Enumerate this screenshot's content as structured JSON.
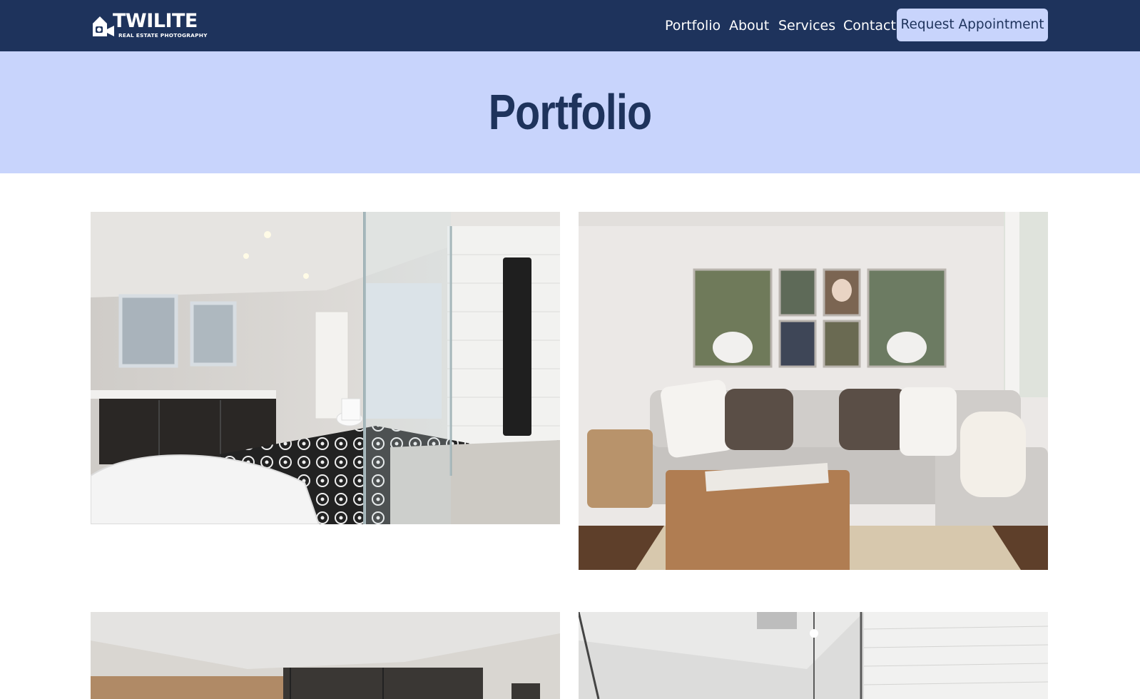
{
  "brand": {
    "name": "TWILITE",
    "tagline": "REAL ESTATE PHOTOGRAPHY",
    "logo_icon": "house-camera-icon"
  },
  "nav": {
    "items": [
      {
        "label": "Portfolio"
      },
      {
        "label": "About"
      },
      {
        "label": "Services"
      },
      {
        "label": "Contact"
      }
    ],
    "cta_label": "Request Appointment"
  },
  "hero": {
    "title": "Portfolio"
  },
  "colors": {
    "nav_bg": "#1e335c",
    "accent": "#c8d4fc",
    "title": "#1e335c"
  },
  "gallery": {
    "photos": [
      {
        "subject": "bathroom-photo"
      },
      {
        "subject": "living-room-photo"
      },
      {
        "subject": "bedroom-photo"
      },
      {
        "subject": "shower-photo"
      }
    ]
  }
}
